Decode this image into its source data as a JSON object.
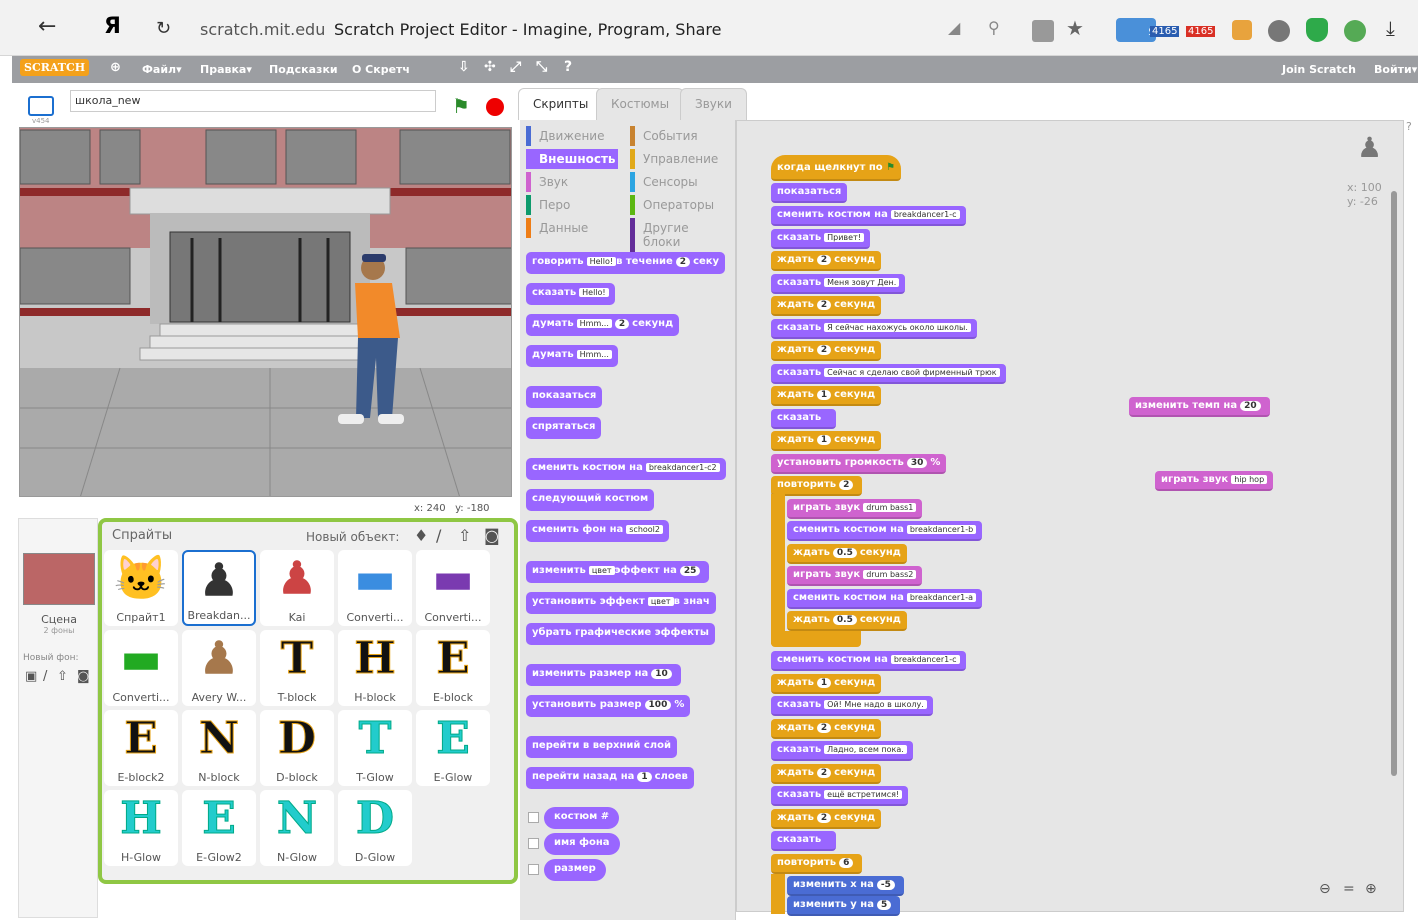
{
  "browser": {
    "logo": "Я",
    "url": "scratch.mit.edu",
    "title": "Scratch Project Editor - Imagine, Program, Share",
    "badge1": "4165",
    "badge2": "4165",
    "badge0": "5"
  },
  "menu": {
    "logo": "SCRATCH",
    "file": "Файл▾",
    "edit": "Правка▾",
    "tips": "Подсказки",
    "about": "О Скретч",
    "join": "Join Scratch",
    "signin": "Войти▾"
  },
  "stage": {
    "project_name": "школа_new",
    "version": "v454",
    "x": "x: 240",
    "y": "y: -180"
  },
  "left": {
    "scene": "Сцена",
    "backdrops": "2 фоны",
    "new_backdrop": "Новый фон:"
  },
  "sprites": {
    "title": "Спрайты",
    "new_object": "Новый объект:",
    "items": [
      "Спрайт1",
      "Breakdan...",
      "Kai",
      "Converti...",
      "Converti...",
      "Converti...",
      "Avery W...",
      "T-block",
      "H-block",
      "E-block",
      "E-block2",
      "N-block",
      "D-block",
      "T-Glow",
      "E-Glow",
      "H-Glow",
      "E-Glow2",
      "N-Glow",
      "D-Glow"
    ]
  },
  "tabs": [
    "Скрипты",
    "Костюмы",
    "Звуки"
  ],
  "categories": {
    "left": [
      "Движение",
      "Внешность",
      "Звук",
      "Перо",
      "Данные"
    ],
    "right": [
      "События",
      "Управление",
      "Сенсоры",
      "Операторы",
      "Другие блоки"
    ]
  },
  "palette": [
    {
      "t": "говорить",
      "a": "Hello!",
      "b": "в течение",
      "n": "2",
      "c": "секу"
    },
    {
      "t": "сказать",
      "a": "Hello!"
    },
    {
      "t": "думать",
      "a": "Hmm...",
      "n": "2",
      "c": "секунд"
    },
    {
      "t": "думать",
      "a": "Hmm..."
    },
    {
      "t": "показаться"
    },
    {
      "t": "спрятаться"
    },
    {
      "t": "сменить костюм на",
      "a": "breakdancer1-c2"
    },
    {
      "t": "следующий костюм"
    },
    {
      "t": "сменить фон на",
      "a": "school2"
    },
    {
      "t": "изменить",
      "a": "цвет",
      "b": "эффект на",
      "n": "25"
    },
    {
      "t": "установить эффект",
      "a": "цвет",
      "b": "в знач"
    },
    {
      "t": "убрать графические эффекты"
    },
    {
      "t": "изменить размер на",
      "n": "10"
    },
    {
      "t": "установить размер",
      "n": "100",
      "c": "%"
    },
    {
      "t": "перейти в верхний слой"
    },
    {
      "t": "перейти назад на",
      "n": "1",
      "c": "слоев"
    },
    {
      "t": "костюм #"
    },
    {
      "t": "имя фона"
    },
    {
      "t": "размер"
    }
  ],
  "script": {
    "hat": "когда щелкнут по",
    "blocks": [
      {
        "k": "v",
        "t": "показаться"
      },
      {
        "k": "v",
        "t": "сменить костюм на",
        "a": "breakdancer1-c"
      },
      {
        "k": "v",
        "t": "сказать",
        "a": "Привет!"
      },
      {
        "k": "c",
        "t": "ждать",
        "n": "2",
        "c": "секунд"
      },
      {
        "k": "v",
        "t": "сказать",
        "a": "Меня зовут Ден."
      },
      {
        "k": "c",
        "t": "ждать",
        "n": "2",
        "c": "секунд"
      },
      {
        "k": "v",
        "t": "сказать",
        "a": "Я сейчас нахожусь около школы."
      },
      {
        "k": "c",
        "t": "ждать",
        "n": "2",
        "c": "секунд"
      },
      {
        "k": "v",
        "t": "сказать",
        "a": "Сейчас я сделаю свой фирменный трюк"
      },
      {
        "k": "c",
        "t": "ждать",
        "n": "1",
        "c": "секунд"
      },
      {
        "k": "v",
        "t": "сказать",
        "a": " "
      },
      {
        "k": "c",
        "t": "ждать",
        "n": "1",
        "c": "секунд"
      },
      {
        "k": "s",
        "t": "установить громкость",
        "n": "30",
        "c": "%"
      },
      {
        "k": "c",
        "t": "повторить",
        "n": "2"
      },
      {
        "k": "s",
        "t": "играть звук",
        "a": "drum bass1",
        "i": 1
      },
      {
        "k": "v",
        "t": "сменить костюм на",
        "a": "breakdancer1-b",
        "i": 1
      },
      {
        "k": "c",
        "t": "ждать",
        "n": "0.5",
        "c": "секунд",
        "i": 1
      },
      {
        "k": "s",
        "t": "играть звук",
        "a": "drum bass2",
        "i": 1
      },
      {
        "k": "v",
        "t": "сменить костюм на",
        "a": "breakdancer1-a",
        "i": 1
      },
      {
        "k": "c",
        "t": "ждать",
        "n": "0.5",
        "c": "секунд",
        "i": 1
      },
      {
        "k": "v",
        "t": "сменить костюм на",
        "a": "breakdancer1-c"
      },
      {
        "k": "c",
        "t": "ждать",
        "n": "1",
        "c": "секунд"
      },
      {
        "k": "v",
        "t": "сказать",
        "a": "Ой! Мне надо в школу."
      },
      {
        "k": "c",
        "t": "ждать",
        "n": "2",
        "c": "секунд"
      },
      {
        "k": "v",
        "t": "сказать",
        "a": "Ладно, всем пока."
      },
      {
        "k": "c",
        "t": "ждать",
        "n": "2",
        "c": "секунд"
      },
      {
        "k": "v",
        "t": "сказать",
        "a": "ещё встретимся!"
      },
      {
        "k": "c",
        "t": "ждать",
        "n": "2",
        "c": "секунд"
      },
      {
        "k": "v",
        "t": "сказать",
        "a": " "
      },
      {
        "k": "c",
        "t": "повторить",
        "n": "6"
      },
      {
        "k": "l",
        "t": "изменить x на",
        "n": "-5",
        "i": 1
      },
      {
        "k": "l",
        "t": "изменить y на",
        "n": "5",
        "i": 1
      }
    ],
    "loose1": {
      "t": "изменить темп на",
      "n": "20"
    },
    "loose2": {
      "t": "играть звук",
      "a": "hip hop"
    },
    "sprite_x": "x: 100",
    "sprite_y": "y: -26"
  }
}
